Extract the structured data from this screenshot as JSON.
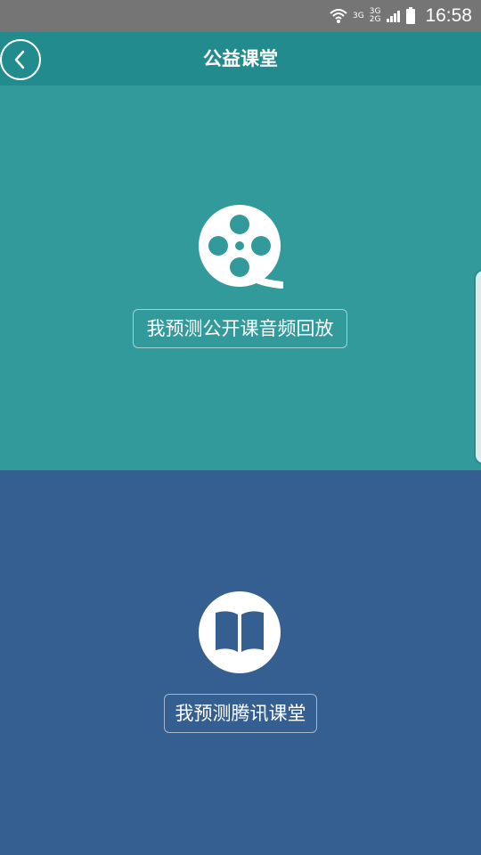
{
  "status_bar": {
    "time": "16:58",
    "net_a_top": "3G",
    "net_b_top": "3G",
    "net_b_bottom": "2G",
    "icons": [
      "wifi-icon",
      "signal-icon",
      "signal-icon",
      "battery-icon"
    ]
  },
  "nav": {
    "title": "公益课堂",
    "back_icon": "chevron-left-icon"
  },
  "sections": {
    "top": {
      "icon": "film-reel-icon",
      "label": "我预测公开课音频回放",
      "color": "#339a9c"
    },
    "bottom": {
      "icon": "open-book-icon",
      "label": "我预测腾讯课堂",
      "color": "#365f91"
    }
  },
  "colors": {
    "status_bar": "#757575",
    "nav_bar": "#228b8d"
  }
}
